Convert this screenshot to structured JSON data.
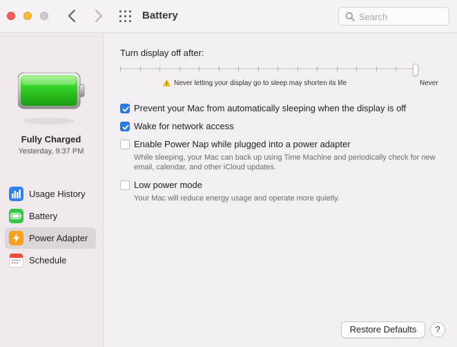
{
  "window": {
    "title": "Battery"
  },
  "search": {
    "placeholder": "Search"
  },
  "sidebar": {
    "status": {
      "title": "Fully Charged",
      "time": "Yesterday, 9:37 PM",
      "charge_percent": 100
    },
    "items": [
      {
        "label": "Usage History",
        "icon": "usage-history-icon",
        "color": "#2f7ff5"
      },
      {
        "label": "Battery",
        "icon": "battery-icon",
        "color": "#33c748"
      },
      {
        "label": "Power Adapter",
        "icon": "power-adapter-icon",
        "color": "#f7a01b"
      },
      {
        "label": "Schedule",
        "icon": "calendar-icon",
        "color": "#ffffff"
      }
    ],
    "selected_index": 2
  },
  "main": {
    "display_off": {
      "label": "Turn display off after:",
      "value": "Never",
      "end_label": "Never",
      "warning": "Never letting your display go to sleep may shorten its life"
    },
    "options": [
      {
        "label": "Prevent your Mac from automatically sleeping when the display is off",
        "checked": true,
        "description": ""
      },
      {
        "label": "Wake for network access",
        "checked": true,
        "description": ""
      },
      {
        "label": "Enable Power Nap while plugged into a power adapter",
        "checked": false,
        "description": "While sleeping, your Mac can back up using Time Machine and periodically check for new email, calendar, and other iCloud updates."
      },
      {
        "label": "Low power mode",
        "checked": false,
        "description": "Your Mac will reduce energy usage and operate more quietly."
      }
    ]
  },
  "footer": {
    "restore_label": "Restore Defaults",
    "help_label": "?"
  }
}
